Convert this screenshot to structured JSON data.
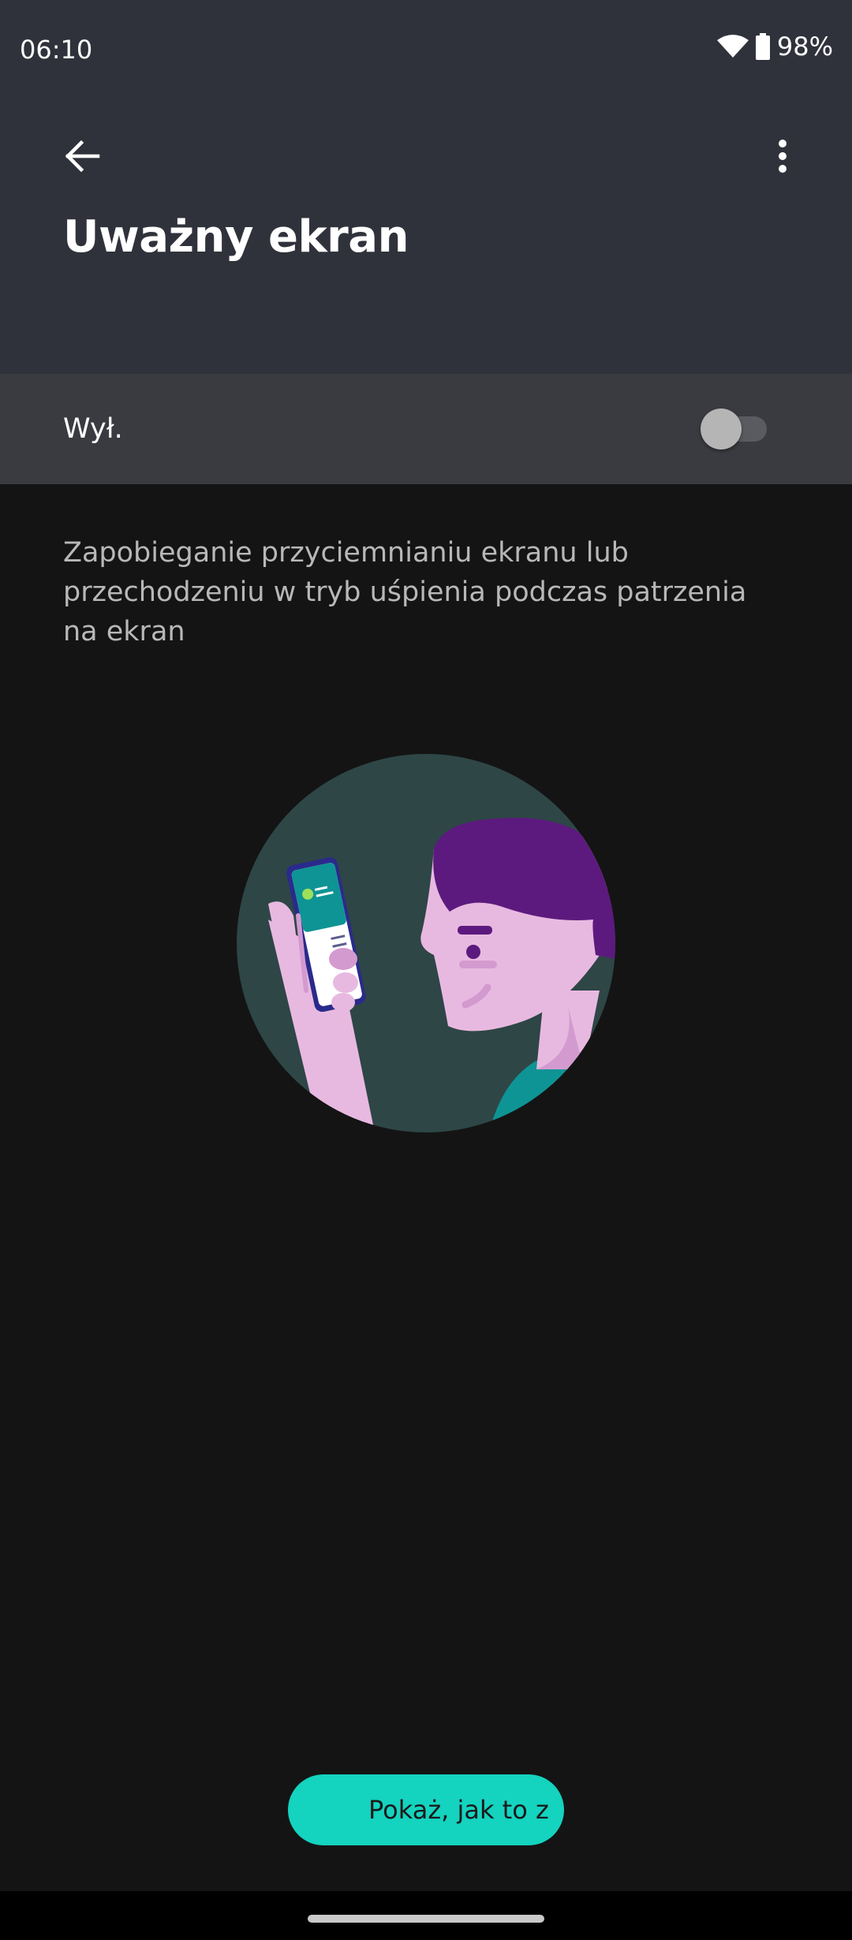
{
  "status_bar": {
    "time": "06:10",
    "battery": "98%",
    "icons": [
      "wifi-icon",
      "battery-icon"
    ]
  },
  "header": {
    "back_icon": "arrow-back-icon",
    "overflow_icon": "more-vert-icon",
    "title": "Uważny ekran"
  },
  "toggle": {
    "label": "Wył.",
    "state": "off"
  },
  "description": "Zapobieganie przyciemnianiu ekranu lub przechodzeniu w tryb uśpienia podczas patrzenia na ekran",
  "cta": {
    "label": "Pokaż, jak to z"
  },
  "colors": {
    "header_bg": "#30323b",
    "toggle_row_bg": "#3a3b40",
    "page_bg": "#141414",
    "accent": "#14d3bf",
    "illustration_bg": "#2e4646",
    "hair": "#5c1a7e",
    "skin": "#e8b9e0"
  }
}
